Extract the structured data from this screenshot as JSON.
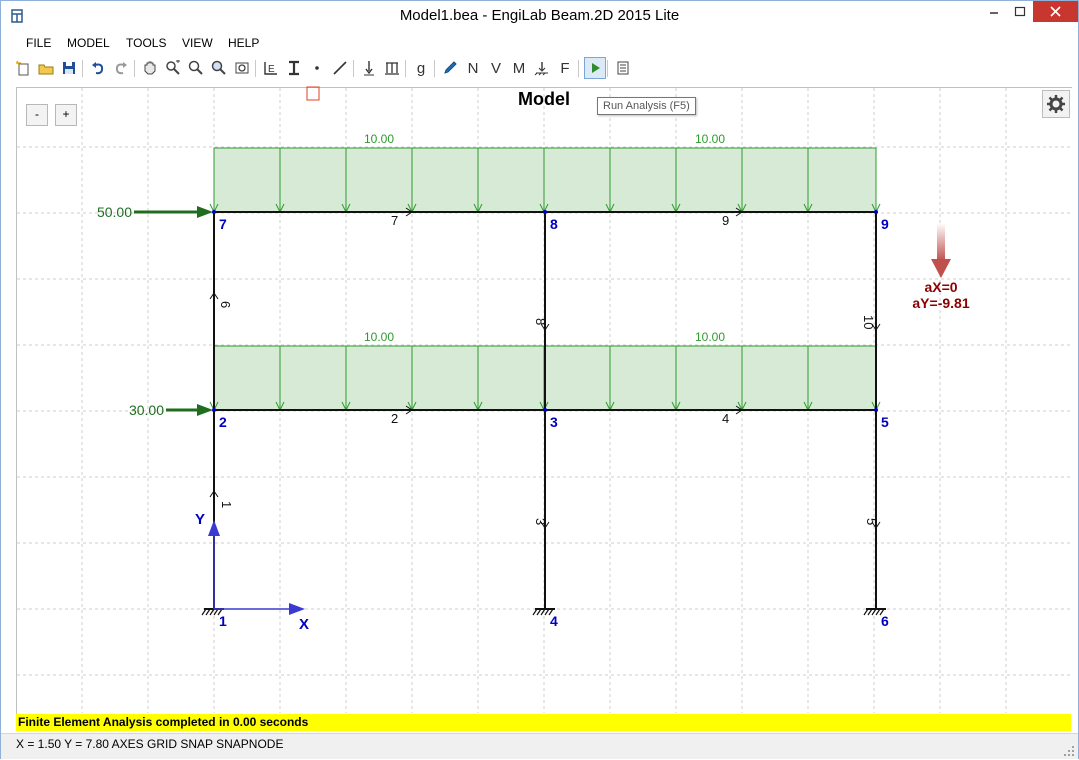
{
  "window": {
    "title": "Model1.bea - EngiLab Beam.2D 2015 Lite",
    "controls": [
      "minimize-icon",
      "maximize-icon",
      "close-icon"
    ]
  },
  "menu": {
    "file": "FILE",
    "model": "MODEL",
    "tools": "TOOLS",
    "view": "VIEW",
    "help": "HELP"
  },
  "toolbar": {
    "letters": {
      "g": "g",
      "n": "N",
      "v": "V",
      "m": "M",
      "f": "F"
    },
    "tooltip": "Run Analysis (F5)"
  },
  "canvas": {
    "zoom_out": "-",
    "zoom_in": "+",
    "title": "Model"
  },
  "model": {
    "nodes": [
      "1",
      "2",
      "3",
      "4",
      "5",
      "6",
      "7",
      "8",
      "9"
    ],
    "elements": [
      "1",
      "2",
      "3",
      "4",
      "5",
      "6",
      "7",
      "8",
      "9",
      "10"
    ],
    "distributed_loads": [
      "10.00",
      "10.00",
      "10.00",
      "10.00"
    ],
    "nodal_loads": [
      "50.00",
      "30.00"
    ],
    "gravity": {
      "ax": "aX=0",
      "ay": "aY=-9.81"
    },
    "axes": {
      "x": "X",
      "y": "Y"
    }
  },
  "status": {
    "message": "Finite Element Analysis completed in 0.00 seconds",
    "coords": "X = 1.50  Y = 7.80  AXES  GRID  SNAP  SNAPNODE"
  },
  "colors": {
    "load_fill": "#d6ead6",
    "load_green": "#2e9b2e",
    "force_green": "#1f6e1f",
    "node_blue": "#0000c0",
    "gravity_red": "#8b0000",
    "status_yellow": "#ffff00"
  }
}
